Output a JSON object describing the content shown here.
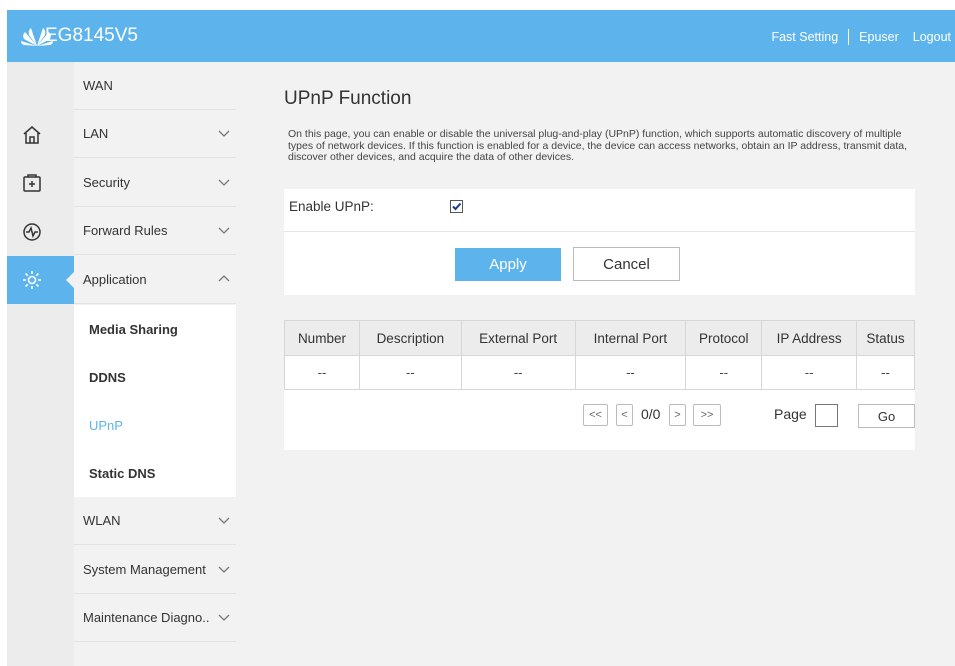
{
  "header": {
    "model": "EG8145V5",
    "links": [
      "Fast Setting",
      "Epuser",
      "Logout"
    ],
    "brand_color": "#5db4ec"
  },
  "rail": {
    "icons": [
      "home-icon",
      "add-box-icon",
      "monitor-pulse-icon",
      "gear-icon"
    ],
    "active": "gear-icon"
  },
  "menu": {
    "items": [
      "WAN",
      "LAN",
      "Security",
      "Forward Rules",
      "Application",
      "WLAN",
      "System Management",
      "Maintenance Diagno.."
    ],
    "sub_items": [
      "Media Sharing",
      "DDNS",
      "UPnP",
      "Static DNS"
    ],
    "selected_sub": "UPnP",
    "accent_color": "#5db4ec"
  },
  "main": {
    "title": "UPnP Function",
    "description": "On this page, you can enable or disable the universal plug-and-play (UPnP) function, which supports automatic discovery of multiple types of network devices. If this function is enabled for a device, the device can access networks, obtain an IP address, transmit data, discover other devices, and acquire the data of other devices.",
    "enable_label": "Enable UPnP:",
    "enable_checked": true,
    "apply_label": "Apply",
    "cancel_label": "Cancel"
  },
  "table": {
    "columns": [
      "Number",
      "Description",
      "External Port",
      "Internal Port",
      "Protocol",
      "IP Address",
      "Status"
    ],
    "rows": [
      [
        "--",
        "--",
        "--",
        "--",
        "--",
        "--",
        "--"
      ]
    ]
  },
  "pager": {
    "first": "<<",
    "prev": "<",
    "info": "0/0",
    "next": ">",
    "last": ">>",
    "page_label": "Page",
    "go_label": "Go"
  }
}
